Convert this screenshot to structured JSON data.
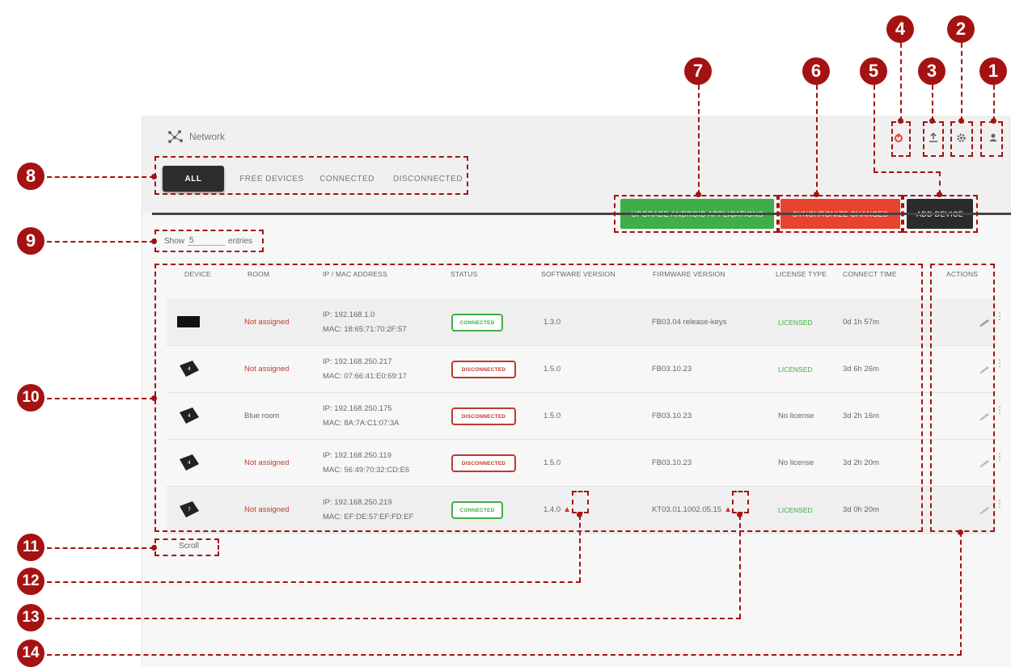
{
  "app": {
    "title": "Network"
  },
  "tabs": [
    {
      "label": "ALL"
    },
    {
      "label": "FREE DEVICES"
    },
    {
      "label": "CONNECTED"
    },
    {
      "label": "DISCONNECTED"
    }
  ],
  "top_icons": [
    "power-icon",
    "upload-icon",
    "gear-icon",
    "user-icon"
  ],
  "buttons": {
    "upgrade": "UPGRADE ANDROID APPLICATIONS",
    "synchronize": "SYNCHRONIZE CHANGES",
    "add_device": "ADD DEVICE"
  },
  "show_entries": {
    "prefix": "Show",
    "value": "5",
    "suffix": "entries"
  },
  "table": {
    "headers": [
      "DEVICE",
      "ROOM",
      "IP / MAC ADDRESS",
      "STATUS",
      "SOFTWARE VERSION",
      "FIRMWARE VERSION",
      "LICENSE TYPE",
      "CONNECT TIME",
      "ACTIONS"
    ],
    "rows": [
      {
        "room": "Not assigned",
        "ip": "IP: 192.168.1.0",
        "mac": "MAC: 18:65:71:70:2F:57",
        "status": "CONNECTED",
        "software": "1.3.0",
        "firmware": "FB03.04 release-keys",
        "license": "LICENSED",
        "time": "0d 1h 57m"
      },
      {
        "room": "Not assigned",
        "ip": "IP: 192.168.250.217",
        "mac": "MAC: 07:66:41:E0:69:17",
        "status": "DISCONNECTED",
        "software": "1.5.0",
        "firmware": "FB03.10.23",
        "license": "LICENSED",
        "time": "3d 6h 26m"
      },
      {
        "room": "Blue room",
        "ip": "IP: 192.168.250.175",
        "mac": "MAC: 8A:7A:C1:07:3A",
        "status": "DISCONNECTED",
        "software": "1.5.0",
        "firmware": "FB03.10.23",
        "license": "No license",
        "time": "3d 2h 16m"
      },
      {
        "room": "Not assigned",
        "ip": "IP: 192.168.250.119",
        "mac": "MAC: 56:49:70:32:CD:E6",
        "status": "DISCONNECTED",
        "software": "1.5.0",
        "firmware": "FB03.10.23",
        "license": "No license",
        "time": "3d 2h 20m"
      },
      {
        "room": "Not assigned",
        "ip": "IP: 192.168.250.219",
        "mac": "MAC: EF:DE:57:EF:FD:EF",
        "status": "CONNECTED",
        "software": "1.4.0",
        "firmware": "KT03.01.1002.05.15",
        "license": "LICENSED",
        "time": "3d 0h 20m"
      }
    ]
  },
  "scroll_label": "Scroll",
  "markers": [
    "1",
    "2",
    "3",
    "4",
    "5",
    "6",
    "7",
    "8",
    "9",
    "10",
    "11",
    "12",
    "13",
    "14"
  ],
  "colors": {
    "annotation": "#a51212",
    "green": "#3fae49",
    "red": "#e8432f",
    "dark": "#2b2b2b"
  }
}
